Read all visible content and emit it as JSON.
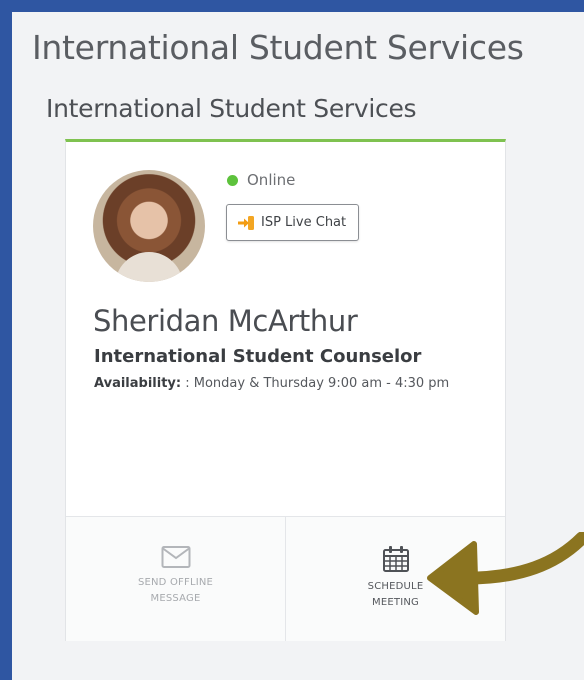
{
  "page": {
    "title": "International Student Services",
    "section_title": "International Student Services"
  },
  "card": {
    "status_text": "Online",
    "chat_button_label": "ISP Live Chat",
    "name": "Sheridan McArthur",
    "role": "International Student Counselor",
    "availability_label": "Availability:",
    "availability_value": ": Monday & Thursday 9:00 am - 4:30 pm",
    "actions": {
      "offline_label": "SEND OFFLINE\nMESSAGE",
      "meeting_label": "SCHEDULE\nMEETING"
    }
  },
  "colors": {
    "background": "#2f56a2",
    "panel": "#f2f3f5",
    "status_online": "#5dc23c",
    "card_accent": "#7fc250",
    "annotation_arrow": "#8b7420"
  },
  "icons": {
    "chat": "sign-in-arrow-icon",
    "offline": "envelope-icon",
    "meeting": "calendar-icon",
    "annotation": "curved-arrow-icon"
  }
}
